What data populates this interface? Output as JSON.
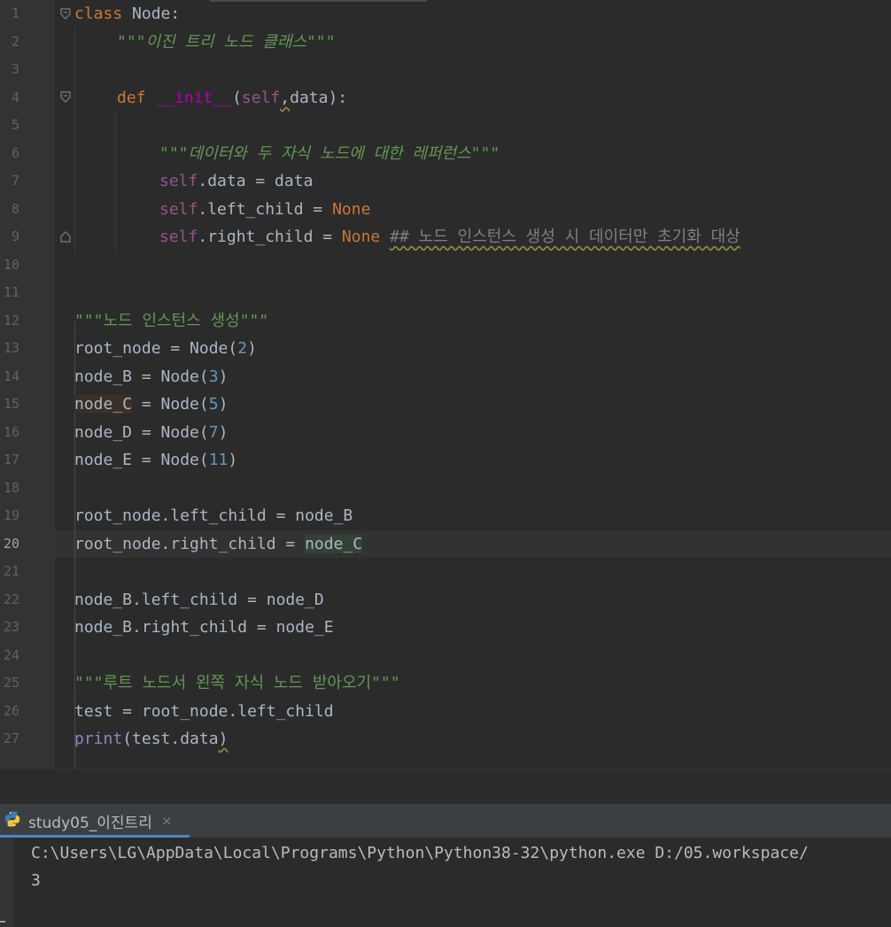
{
  "editor": {
    "line_numbers": [
      "1",
      "2",
      "3",
      "4",
      "5",
      "6",
      "7",
      "8",
      "9",
      "10",
      "11",
      "12",
      "13",
      "14",
      "15",
      "16",
      "17",
      "18",
      "19",
      "20",
      "21",
      "22",
      "23",
      "24",
      "25",
      "26",
      "27"
    ],
    "current_line": "20",
    "code": {
      "l1_kw": "class",
      "l1_rest": " Node:",
      "l2_doc": "\"\"\"이진 트리 노드 클래스\"\"\"",
      "l4_kw": "def",
      "l4_fn": "__init__",
      "l4_open": "(",
      "l4_self": "self",
      "l4_comma": ",",
      "l4_rest": "data):",
      "l6_doc": "\"\"\"데이터와 두 자식 노드에 대한 레퍼런스\"\"\"",
      "l7_self": "self",
      "l7_rest": ".data = data",
      "l8_self": "self",
      "l8_rest": ".left_child = ",
      "l8_none": "None",
      "l9_self": "self",
      "l9_rest": ".right_child = ",
      "l9_none": "None",
      "l9_comment": "## 노드 인스턴스 생성 시 데이터만 초기화 대상",
      "l12_doc": "\"\"\"노드 인스턴스 생성\"\"\"",
      "l13_a": "root_node = Node(",
      "l13_n": "2",
      "l14_a": "node_B = Node(",
      "l14_n": "3",
      "l15_var": "node_C",
      "l15_a": " = Node(",
      "l15_n": "5",
      "l16_a": "node_D = Node(",
      "l16_n": "7",
      "l17_a": "node_E = Node(",
      "l17_n": "11",
      "close_paren": ")",
      "l19": "root_node.left_child = node_B",
      "l20_a": "root_node.right_child = ",
      "l20_var": "node_C",
      "l22": "node_B.left_child = node_D",
      "l23": "node_B.right_child = node_E",
      "l25_doc": "\"\"\"루트 노드서 왼쪽 자식 노드 받아오기\"\"\"",
      "l26": "test = root_node.left_child",
      "l27_fn": "print",
      "l27_rest": "(test.data",
      "l27_close": ")"
    }
  },
  "run_panel": {
    "tab_label": "study05_이진트리",
    "tab_icon": "python-icon",
    "close_glyph": "×"
  },
  "console": {
    "lines": [
      "C:\\Users\\LG\\AppData\\Local\\Programs\\Python\\Python38-32\\python.exe D:/05.workspace/",
      "3"
    ]
  },
  "colors": {
    "background": "#2b2b2b",
    "keyword": "#cc7832",
    "self": "#94558d",
    "docstring": "#629755",
    "number": "#6897bb",
    "function": "#b200b2",
    "builtin": "#8888c6",
    "tab_underline": "#4a88c7"
  }
}
